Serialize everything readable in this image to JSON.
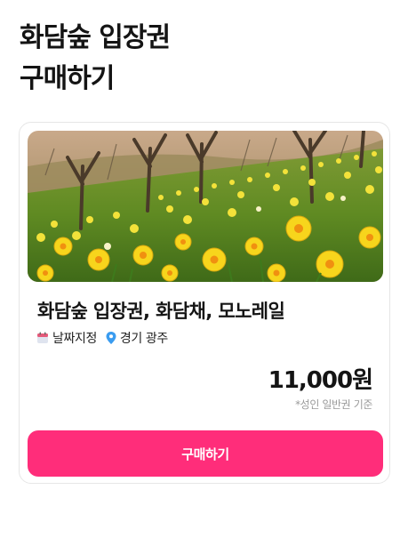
{
  "header": {
    "title_line1": "화담숲 입장권",
    "title_line2": "구매하기"
  },
  "product": {
    "image_alt": "yellow daffodil field",
    "name": "화담숲 입장권, 화담채, 모노레일",
    "date_icon": "calendar-icon",
    "date_label": "날짜지정",
    "location_icon": "location-pin-icon",
    "location_label": "경기 광주",
    "price": "11,000원",
    "price_note": "*성인 일반권 기준"
  },
  "actions": {
    "buy_label": "구매하기"
  },
  "colors": {
    "accent": "#ff2d7a",
    "calendar": "#e55a7a",
    "pin": "#3a9cf0"
  }
}
